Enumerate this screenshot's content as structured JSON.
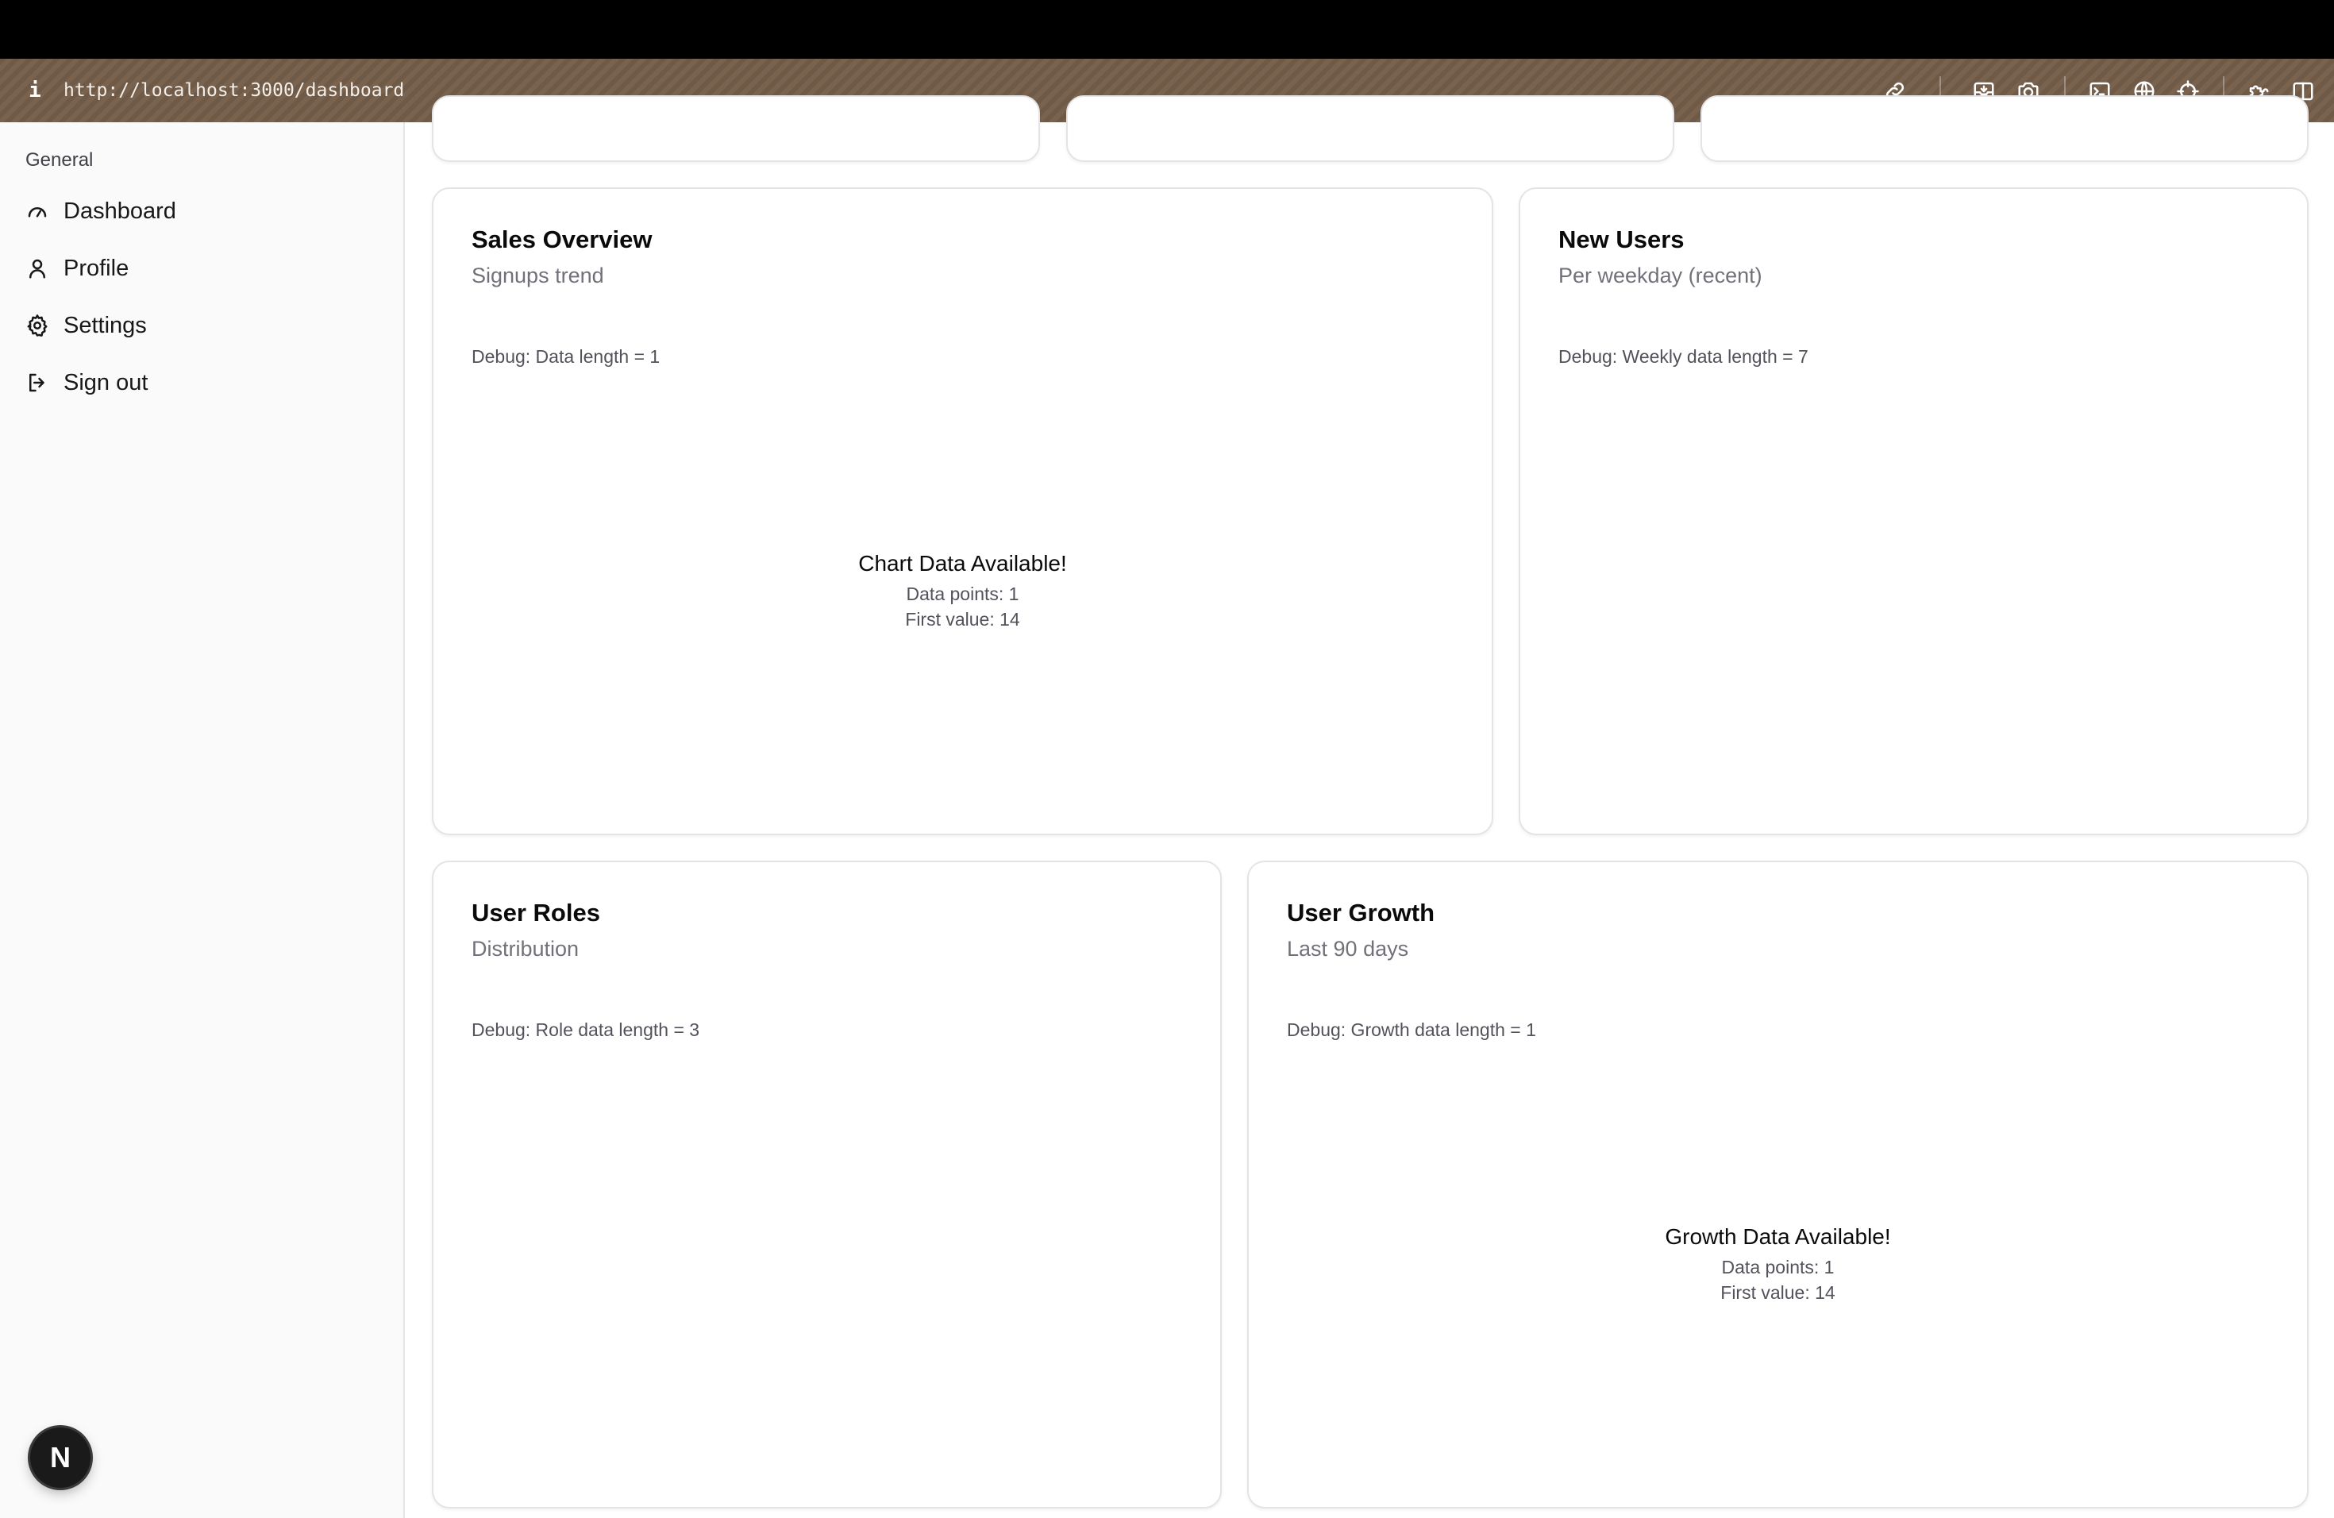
{
  "browser": {
    "url": "http://localhost:3000/dashboard"
  },
  "toolbar_icons": [
    "link-icon",
    "inbox-icon",
    "camera-icon",
    "terminal-icon",
    "globe-icon",
    "crosshair-icon",
    "puzzle-icon",
    "split-view-icon"
  ],
  "sidebar": {
    "group_label": "General",
    "items": [
      {
        "label": "Dashboard",
        "icon": "gauge-icon"
      },
      {
        "label": "Profile",
        "icon": "user-icon"
      },
      {
        "label": "Settings",
        "icon": "gear-icon"
      },
      {
        "label": "Sign out",
        "icon": "logout-icon"
      }
    ]
  },
  "next_badge": {
    "letter": "N"
  },
  "cards": {
    "sales": {
      "title": "Sales Overview",
      "subtitle": "Signups trend",
      "debug": "Debug: Data length = 1",
      "headline": "Chart Data Available!",
      "line1": "Data points: 1",
      "line2": "First value: 14"
    },
    "new_users": {
      "title": "New Users",
      "subtitle": "Per weekday (recent)",
      "debug": "Debug: Weekly data length = 7"
    },
    "roles": {
      "title": "User Roles",
      "subtitle": "Distribution",
      "debug": "Debug: Role data length = 3"
    },
    "growth": {
      "title": "User Growth",
      "subtitle": "Last 90 days",
      "debug": "Debug: Growth data length = 1",
      "headline": "Growth Data Available!",
      "line1": "Data points: 1",
      "line2": "First value: 14"
    }
  }
}
